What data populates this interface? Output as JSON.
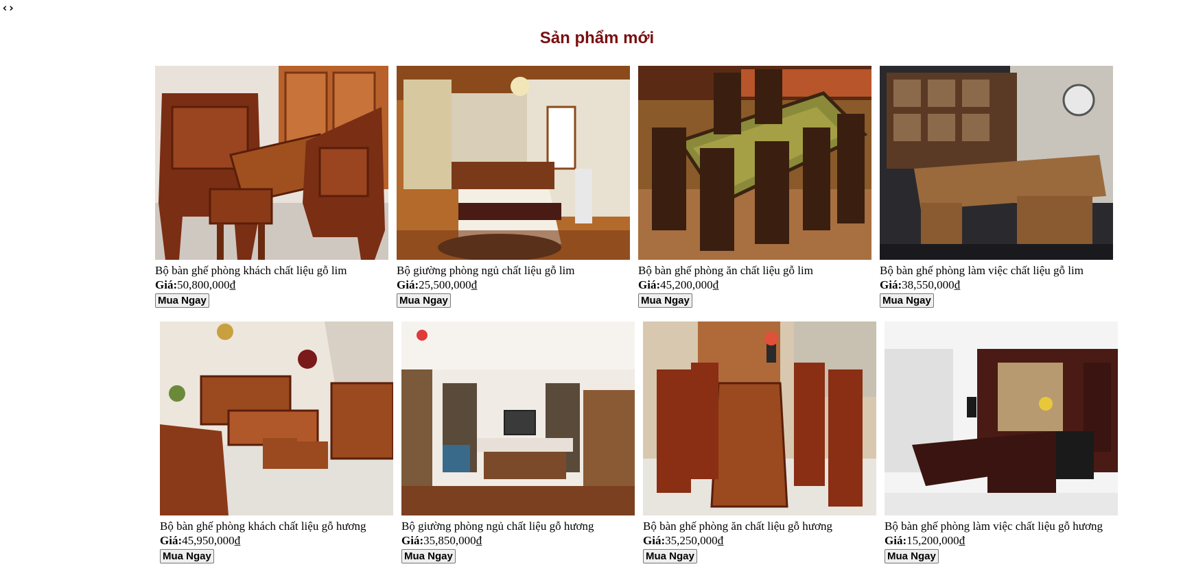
{
  "nav": {
    "code_icon": "‹›"
  },
  "section": {
    "title": "Sản phẩm mới"
  },
  "colors": {
    "title": "#7a0e10",
    "wood_dark": "#5a2410",
    "wood": "#8b3a1a"
  },
  "products": [
    {
      "name": "Bộ bàn ghế phòng khách chất liệu gỗ lim",
      "price_label": "Giá:",
      "price": "50,800,000₫",
      "button": "Mua Ngay",
      "image": "living-room-set"
    },
    {
      "name": "Bộ giường phòng ngủ chất liệu gỗ lim",
      "price_label": "Giá:",
      "price": "25,500,000₫",
      "button": "Mua Ngay",
      "image": "bedroom-set"
    },
    {
      "name": "Bộ bàn ghế phòng ăn chất liệu gỗ lim",
      "price_label": "Giá:",
      "price": "45,200,000₫",
      "button": "Mua Ngay",
      "image": "dining-set"
    },
    {
      "name": "Bộ bàn ghế phòng làm việc chất liệu gỗ lim",
      "price_label": "Giá:",
      "price": "38,550,000₫",
      "button": "Mua Ngay",
      "image": "office-set"
    },
    {
      "name": "Bộ bàn ghế phòng khách chất liệu gỗ hương",
      "price_label": "Giá:",
      "price": "45,950,000₫",
      "button": "Mua Ngay",
      "image": "living-room-set"
    },
    {
      "name": "Bộ giường phòng ngủ chất liệu gỗ hương",
      "price_label": "Giá:",
      "price": "35,850,000₫",
      "button": "Mua Ngay",
      "image": "bedroom-set"
    },
    {
      "name": "Bộ bàn ghế phòng ăn chất liệu gỗ hương",
      "price_label": "Giá:",
      "price": "35,250,000₫",
      "button": "Mua Ngay",
      "image": "dining-set"
    },
    {
      "name": "Bộ bàn ghế phòng làm việc chất liệu gỗ hương",
      "price_label": "Giá:",
      "price": "15,200,000₫",
      "button": "Mua Ngay",
      "image": "office-set"
    }
  ]
}
